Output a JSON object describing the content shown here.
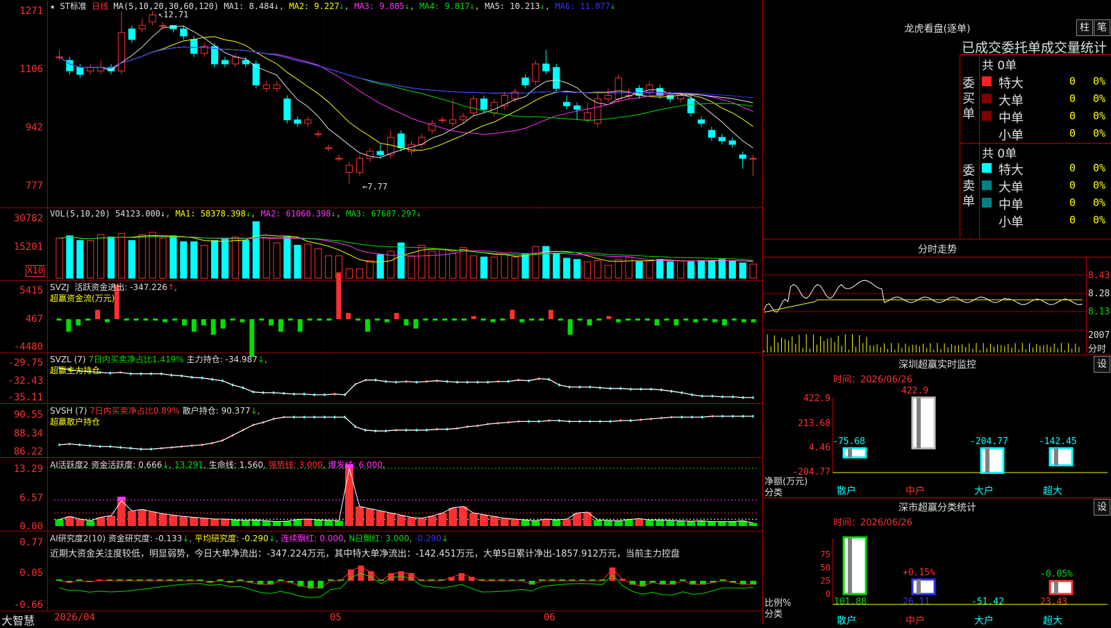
{
  "chart_data": [
    {
      "type": "candlestick",
      "header": {
        "symbol": "ST标准",
        "period": "日线",
        "ma_label": "MA(5,10,20,30,60,120)",
        "ma_values": [
          {
            "name": "MA1",
            "value": "8.484",
            "arrow": "↓",
            "color": "#e0e0e0"
          },
          {
            "name": "MA2",
            "value": "9.227",
            "arrow": "↓",
            "color": "#ffff00"
          },
          {
            "name": "MA3",
            "value": "9.885",
            "arrow": "↓",
            "color": "#ff33ff"
          },
          {
            "name": "MA4",
            "value": "9.817",
            "arrow": "↓",
            "color": "#00e000"
          },
          {
            "name": "MA5",
            "value": "10.213",
            "arrow": "↓",
            "color": "#e0e0e0"
          },
          {
            "name": "MA6",
            "value": "11.077",
            "arrow": "↓",
            "color": "#3333ff"
          }
        ]
      },
      "yticks": [
        "1271",
        "1106",
        "942",
        "777"
      ],
      "high_label": "12.71",
      "low_label": "7.77",
      "candles": [
        {
          "o": 11.4,
          "c": 11.4,
          "h": 11.6,
          "l": 11.3
        },
        {
          "o": 11.3,
          "c": 11.0,
          "h": 11.4,
          "l": 10.9
        },
        {
          "o": 11.1,
          "c": 10.9,
          "h": 11.2,
          "l": 10.8
        },
        {
          "o": 11.0,
          "c": 11.1,
          "h": 11.2,
          "l": 10.9
        },
        {
          "o": 11.0,
          "c": 11.1,
          "h": 11.3,
          "l": 10.9
        },
        {
          "o": 11.1,
          "c": 11.0,
          "h": 11.2,
          "l": 10.9
        },
        {
          "o": 11.0,
          "c": 12.1,
          "h": 12.71,
          "l": 10.9
        },
        {
          "o": 12.2,
          "c": 11.9,
          "h": 12.3,
          "l": 11.8
        },
        {
          "o": 12.2,
          "c": 12.3,
          "h": 12.5,
          "l": 12.1
        },
        {
          "o": 12.4,
          "c": 12.6,
          "h": 12.71,
          "l": 12.3
        },
        {
          "o": 12.3,
          "c": 12.3,
          "h": 12.4,
          "l": 12.2
        },
        {
          "o": 12.3,
          "c": 12.2,
          "h": 12.3,
          "l": 12.1
        },
        {
          "o": 12.2,
          "c": 12.0,
          "h": 12.3,
          "l": 11.9
        },
        {
          "o": 11.9,
          "c": 11.5,
          "h": 12.0,
          "l": 11.4
        },
        {
          "o": 11.5,
          "c": 11.7,
          "h": 11.8,
          "l": 11.4
        },
        {
          "o": 11.7,
          "c": 11.2,
          "h": 11.8,
          "l": 11.1
        },
        {
          "o": 11.3,
          "c": 11.2,
          "h": 11.4,
          "l": 11.1
        },
        {
          "o": 11.2,
          "c": 11.4,
          "h": 11.5,
          "l": 11.1
        },
        {
          "o": 11.3,
          "c": 11.2,
          "h": 11.4,
          "l": 11.1
        },
        {
          "o": 11.2,
          "c": 10.6,
          "h": 11.3,
          "l": 10.5
        },
        {
          "o": 10.5,
          "c": 10.6,
          "h": 10.7,
          "l": 10.4
        },
        {
          "o": 10.5,
          "c": 10.6,
          "h": 10.7,
          "l": 10.4
        },
        {
          "o": 10.2,
          "c": 9.6,
          "h": 10.3,
          "l": 9.5
        },
        {
          "o": 9.6,
          "c": 9.5,
          "h": 9.7,
          "l": 9.4
        },
        {
          "o": 9.5,
          "c": 9.6,
          "h": 9.7,
          "l": 9.4
        },
        {
          "o": 9.2,
          "c": 9.2,
          "h": 9.3,
          "l": 9.1
        },
        {
          "o": 8.8,
          "c": 8.8,
          "h": 8.9,
          "l": 8.7
        },
        {
          "o": 8.5,
          "c": 8.5,
          "h": 8.6,
          "l": 8.4
        },
        {
          "o": 8.1,
          "c": 8.3,
          "h": 8.4,
          "l": 7.77
        },
        {
          "o": 8.1,
          "c": 8.5,
          "h": 8.6,
          "l": 8.0
        },
        {
          "o": 8.5,
          "c": 8.7,
          "h": 8.8,
          "l": 8.4
        },
        {
          "o": 8.7,
          "c": 8.6,
          "h": 8.9,
          "l": 8.5
        },
        {
          "o": 8.6,
          "c": 9.1,
          "h": 9.3,
          "l": 8.5
        },
        {
          "o": 9.2,
          "c": 8.8,
          "h": 9.3,
          "l": 8.7
        },
        {
          "o": 8.7,
          "c": 8.9,
          "h": 9.0,
          "l": 8.6
        },
        {
          "o": 8.9,
          "c": 9.1,
          "h": 9.2,
          "l": 8.8
        },
        {
          "o": 9.3,
          "c": 9.5,
          "h": 9.6,
          "l": 9.2
        },
        {
          "o": 9.6,
          "c": 9.6,
          "h": 9.7,
          "l": 9.5
        },
        {
          "o": 9.5,
          "c": 9.6,
          "h": 10.2,
          "l": 9.4
        },
        {
          "o": 9.6,
          "c": 9.7,
          "h": 9.8,
          "l": 9.5
        },
        {
          "o": 9.8,
          "c": 10.2,
          "h": 10.3,
          "l": 9.7
        },
        {
          "o": 10.2,
          "c": 9.9,
          "h": 10.3,
          "l": 9.8
        },
        {
          "o": 9.8,
          "c": 10.1,
          "h": 10.2,
          "l": 9.7
        },
        {
          "o": 10.0,
          "c": 10.3,
          "h": 10.4,
          "l": 9.9
        },
        {
          "o": 10.2,
          "c": 10.4,
          "h": 10.5,
          "l": 10.1
        },
        {
          "o": 10.8,
          "c": 10.6,
          "h": 10.9,
          "l": 10.5
        },
        {
          "o": 10.7,
          "c": 11.2,
          "h": 11.3,
          "l": 10.6
        },
        {
          "o": 11.2,
          "c": 11.0,
          "h": 11.6,
          "l": 10.9
        },
        {
          "o": 11.1,
          "c": 10.5,
          "h": 11.2,
          "l": 10.4
        },
        {
          "o": 10.1,
          "c": 10.0,
          "h": 10.3,
          "l": 9.9
        },
        {
          "o": 10.0,
          "c": 9.9,
          "h": 10.1,
          "l": 9.6
        },
        {
          "o": 9.6,
          "c": 9.8,
          "h": 10.1,
          "l": 9.5
        },
        {
          "o": 9.5,
          "c": 10.2,
          "h": 10.4,
          "l": 9.4
        },
        {
          "o": 10.2,
          "c": 10.3,
          "h": 10.5,
          "l": 10.1
        },
        {
          "o": 10.2,
          "c": 10.8,
          "h": 10.9,
          "l": 10.1
        },
        {
          "o": 10.3,
          "c": 10.3,
          "h": 10.5,
          "l": 10.2
        },
        {
          "o": 10.5,
          "c": 10.3,
          "h": 10.6,
          "l": 10.2
        },
        {
          "o": 10.4,
          "c": 10.6,
          "h": 10.7,
          "l": 10.3
        },
        {
          "o": 10.5,
          "c": 10.3,
          "h": 10.6,
          "l": 10.2
        },
        {
          "o": 10.3,
          "c": 10.2,
          "h": 10.4,
          "l": 10.1
        },
        {
          "o": 10.2,
          "c": 10.3,
          "h": 10.4,
          "l": 10.1
        },
        {
          "o": 10.2,
          "c": 9.8,
          "h": 10.3,
          "l": 9.7
        },
        {
          "o": 9.6,
          "c": 9.5,
          "h": 9.7,
          "l": 9.4
        },
        {
          "o": 9.3,
          "c": 9.1,
          "h": 9.4,
          "l": 9.0
        },
        {
          "o": 9.1,
          "c": 9.0,
          "h": 9.2,
          "l": 8.9
        },
        {
          "o": 9.0,
          "c": 8.9,
          "h": 9.1,
          "l": 8.8
        },
        {
          "o": 8.6,
          "c": 8.5,
          "h": 8.7,
          "l": 8.2
        },
        {
          "o": 8.5,
          "c": 8.5,
          "h": 8.6,
          "l": 8.0
        }
      ]
    },
    {
      "type": "bar",
      "header": {
        "label": "VOL(5,10,20)",
        "value": "54123.000",
        "ma1": "58378.398",
        "ma2": "61060.398",
        "ma3": "67687.297"
      },
      "yticks": [
        "30782",
        "15201",
        "X10"
      ],
      "values": [
        170,
        180,
        160,
        160,
        185,
        175,
        190,
        160,
        185,
        195,
        170,
        180,
        155,
        155,
        140,
        160,
        170,
        175,
        160,
        240,
        170,
        150,
        175,
        140,
        145,
        125,
        95,
        95,
        40,
        40,
        75,
        100,
        115,
        150,
        95,
        140,
        115,
        120,
        105,
        130,
        95,
        90,
        90,
        100,
        90,
        105,
        135,
        135,
        105,
        85,
        80,
        70,
        75,
        55,
        80,
        90,
        70,
        75,
        80,
        70,
        75,
        70,
        75,
        75,
        80,
        75,
        65,
        60
      ]
    },
    {
      "type": "bar",
      "header": {
        "name": "SVZJ",
        "label": "活跃资金进出:",
        "value": "-347.226",
        "subtitle": "超赢资金流(万元)"
      },
      "yticks": [
        "5415",
        "467",
        "-4480"
      ],
      "values": [
        0,
        -20,
        -10,
        0,
        15,
        -5,
        55,
        0,
        0,
        0,
        0,
        -5,
        0,
        -10,
        -20,
        -10,
        -25,
        -15,
        0,
        -5,
        -60,
        0,
        -10,
        -20,
        0,
        -20,
        0,
        0,
        0,
        75,
        10,
        0,
        -20,
        0,
        -5,
        10,
        -10,
        -15,
        0,
        0,
        0,
        0,
        0,
        5,
        0,
        -5,
        0,
        15,
        -5,
        0,
        0,
        15,
        0,
        -25,
        0,
        -10,
        0,
        5,
        -5,
        0,
        0,
        0,
        -10,
        0,
        -10,
        0,
        -5,
        0,
        -5,
        -10,
        0,
        -5,
        -5
      ]
    },
    {
      "type": "line",
      "header": {
        "name": "SVZL",
        "period": "(7)",
        "desc": "7日内买卖净占比1.419%",
        "label": "主力持仓:",
        "value": "-34.987",
        "subtitle": "超赢主力持仓"
      },
      "yticks": [
        "-29.75",
        "-32.43",
        "-35.11"
      ],
      "values": [
        -30.8,
        -31.0,
        -31.2,
        -31.3,
        -31.4,
        -31.5,
        -31.4,
        -31.6,
        -31.6,
        -31.6,
        -31.6,
        -31.8,
        -31.9,
        -32.1,
        -32.2,
        -32.4,
        -32.6,
        -33.2,
        -33.6,
        -34.2,
        -34.3,
        -34.3,
        -34.4,
        -34.5,
        -34.5,
        -34.6,
        -34.6,
        -34.5,
        -34.6,
        -33.1,
        -32.5,
        -32.5,
        -32.7,
        -32.8,
        -32.7,
        -32.8,
        -32.7,
        -32.6,
        -32.7,
        -32.8,
        -32.8,
        -32.8,
        -32.8,
        -32.7,
        -32.7,
        -32.5,
        -32.6,
        -32.3,
        -32.4,
        -33.2,
        -33.5,
        -33.5,
        -33.5,
        -33.6,
        -33.7,
        -33.7,
        -33.8,
        -33.8,
        -33.8,
        -33.9,
        -34.1,
        -34.3,
        -34.6,
        -34.8,
        -34.8,
        -34.9,
        -34.9,
        -35.0,
        -35.0
      ]
    },
    {
      "type": "line",
      "header": {
        "name": "SVSH",
        "period": "(7)",
        "desc": "7日内买卖净占比0.89%",
        "label": "散户持仓:",
        "value": "90.377",
        "subtitle": "超赢散户持仓"
      },
      "yticks": [
        "90.55",
        "88.34",
        "86.22"
      ],
      "values": [
        87.1,
        87.2,
        87.1,
        87.0,
        86.9,
        86.9,
        86.8,
        86.7,
        86.6,
        86.6,
        86.7,
        86.8,
        86.9,
        87.0,
        87.1,
        87.3,
        87.6,
        88.2,
        88.8,
        89.4,
        89.7,
        90.1,
        90.3,
        90.3,
        90.3,
        90.3,
        90.3,
        90.3,
        90.3,
        89.2,
        88.8,
        88.7,
        88.7,
        88.8,
        88.8,
        88.8,
        88.8,
        88.9,
        88.9,
        89.0,
        89.2,
        89.3,
        89.5,
        89.6,
        89.7,
        89.8,
        89.8,
        89.8,
        89.9,
        89.9,
        89.8,
        89.8,
        89.8,
        89.8,
        89.8,
        89.9,
        89.9,
        90.0,
        90.1,
        90.2,
        90.3,
        90.3,
        90.3,
        90.3,
        90.4,
        90.4,
        90.4,
        90.4,
        90.4
      ]
    },
    {
      "type": "bar",
      "header": {
        "name": "AI活跃度2",
        "label": "资金活跃度:",
        "value": "0.666",
        "arrow": "↓",
        "v2": "13.291",
        "life_label": "生命线:",
        "life_value": "1.560",
        "strong_label": "强势线:",
        "strong_value": "3.000",
        "burst_label": "爆发线:",
        "burst_value": "6.000"
      },
      "yticks": [
        "13.29",
        "6.57",
        "0.00"
      ],
      "values": [
        1.5,
        2.2,
        1.6,
        1.2,
        2.0,
        2.4,
        5.8,
        3.5,
        3.8,
        3.3,
        2.8,
        2.5,
        2.2,
        2.0,
        1.8,
        1.6,
        1.6,
        1.4,
        1.3,
        1.4,
        1.2,
        1.0,
        1.1,
        1.5,
        1.6,
        1.4,
        1.3,
        1.2,
        13.29,
        4.5,
        4.0,
        3.5,
        3.0,
        2.5,
        2.0,
        1.8,
        2.3,
        3.0,
        4.2,
        4.5,
        3.0,
        2.6,
        2.2,
        1.8,
        1.6,
        1.4,
        1.2,
        1.6,
        1.4,
        1.6,
        3.0,
        3.2,
        1.4,
        1.3,
        1.2,
        1.5,
        1.7,
        1.4,
        1.4,
        1.3,
        1.2,
        1.1,
        1.2,
        1.0,
        1.0,
        1.0,
        1.2,
        0.7
      ]
    },
    {
      "type": "bar",
      "header": {
        "name": "AI研究度2(10)",
        "label": "资金研究度:",
        "value": "-0.133",
        "avg_label": "平均研究度:",
        "avg_value": "-0.290",
        "lx_label": "连续飘红:",
        "lx_value": "0.000",
        "n_label": "N日飘红:",
        "n_value": "3.000",
        "extra": "-0.290"
      },
      "yticks": [
        "0.77",
        "0.05",
        "-0.66"
      ],
      "values": [
        0,
        -0.05,
        0,
        -0.03,
        0.02,
        0,
        0,
        0,
        0,
        0,
        0,
        0,
        0,
        0,
        0,
        -0.05,
        0,
        -0.05,
        0,
        -0.05,
        -0.1,
        -0.1,
        0,
        -0.05,
        -0.15,
        -0.2,
        -0.2,
        0,
        0,
        0.3,
        0.4,
        0.25,
        0,
        0.2,
        0.25,
        0.2,
        0,
        0,
        0,
        0.1,
        0.2,
        0.1,
        0,
        0,
        0,
        0,
        0,
        -0.1,
        0,
        0,
        0,
        0,
        0,
        0,
        0,
        0.35,
        0.05,
        -0.1,
        -0.15,
        -0.05,
        -0.1,
        -0.1,
        0,
        -0.1,
        -0.1,
        -0.05,
        0,
        -0.05,
        -0.1,
        -0.1
      ]
    }
  ],
  "commentary": "近期大资金关注度较低，明显弱势，今日大单净流出：-347.224万元，其中特大单净流出：-142.451万元，大单5日累计净出-1857.912万元，当前主力控盘",
  "x_axis": {
    "labels": [
      "2026/04",
      "05",
      "06"
    ]
  },
  "brand": "大智慧",
  "right_panels": {
    "lhkp": {
      "title": "龙虎看盘(逐单)",
      "btn1": "柱",
      "btn2": "笔",
      "subtitle": "已成交委托单成交量统计",
      "buy": {
        "title": "委买单",
        "total": "共 0单",
        "rows": [
          {
            "label": "特大",
            "count": "0",
            "pct": "0%",
            "color": "#ff2020"
          },
          {
            "label": "大单",
            "count": "0",
            "pct": "0%",
            "color": "#800000"
          },
          {
            "label": "中单",
            "count": "0",
            "pct": "0%",
            "color": "#800000"
          },
          {
            "label": "小单",
            "count": "0",
            "pct": "0%",
            "color": "#000000"
          }
        ]
      },
      "sell": {
        "title": "委卖单",
        "total": "共 0单",
        "rows": [
          {
            "label": "特大",
            "count": "0",
            "pct": "0%",
            "color": "#00ffff"
          },
          {
            "label": "大单",
            "count": "0",
            "pct": "0%",
            "color": "#008080"
          },
          {
            "label": "中单",
            "count": "0",
            "pct": "0%",
            "color": "#008080"
          },
          {
            "label": "小单",
            "count": "0",
            "pct": "0%",
            "color": "#000000"
          }
        ]
      }
    },
    "fszs": {
      "title": "分时走势",
      "yticks": [
        "8.43",
        "8.28",
        "8.13"
      ],
      "vol_ticks": [
        "2007",
        "分时"
      ]
    },
    "szcy": {
      "title": "深圳超赢实时监控",
      "btn": "设",
      "time_label": "时间：2026/06/26",
      "yticks": [
        "422.9",
        "213.68",
        "4.46",
        "-204.77"
      ],
      "ylabel": "净额(万元)",
      "xlabel": "分类",
      "categories": [
        "散户",
        "中户",
        "大户",
        "超大"
      ],
      "values": [
        -75.68,
        422.9,
        -204.77,
        -142.45
      ],
      "value_labels": [
        "-75.68",
        "422.9",
        "-204.77",
        "-142.45"
      ]
    },
    "scfl": {
      "title": "深市超赢分类统计",
      "btn": "设",
      "time_label": "时间：2026/06/26",
      "yticks": [
        "75",
        "50",
        "25",
        "0"
      ],
      "ylabel": "比例%",
      "xlabel": "分类",
      "categories": [
        "散户",
        "中户",
        "大户",
        "超大"
      ],
      "values": [
        101.88,
        26.11,
        -51.42,
        23.43
      ],
      "value_labels": [
        "101.88",
        "26.11",
        "-51.42",
        "23.43"
      ],
      "change_labels": [
        "",
        "+0.15%",
        "",
        "-0.05%"
      ]
    }
  }
}
